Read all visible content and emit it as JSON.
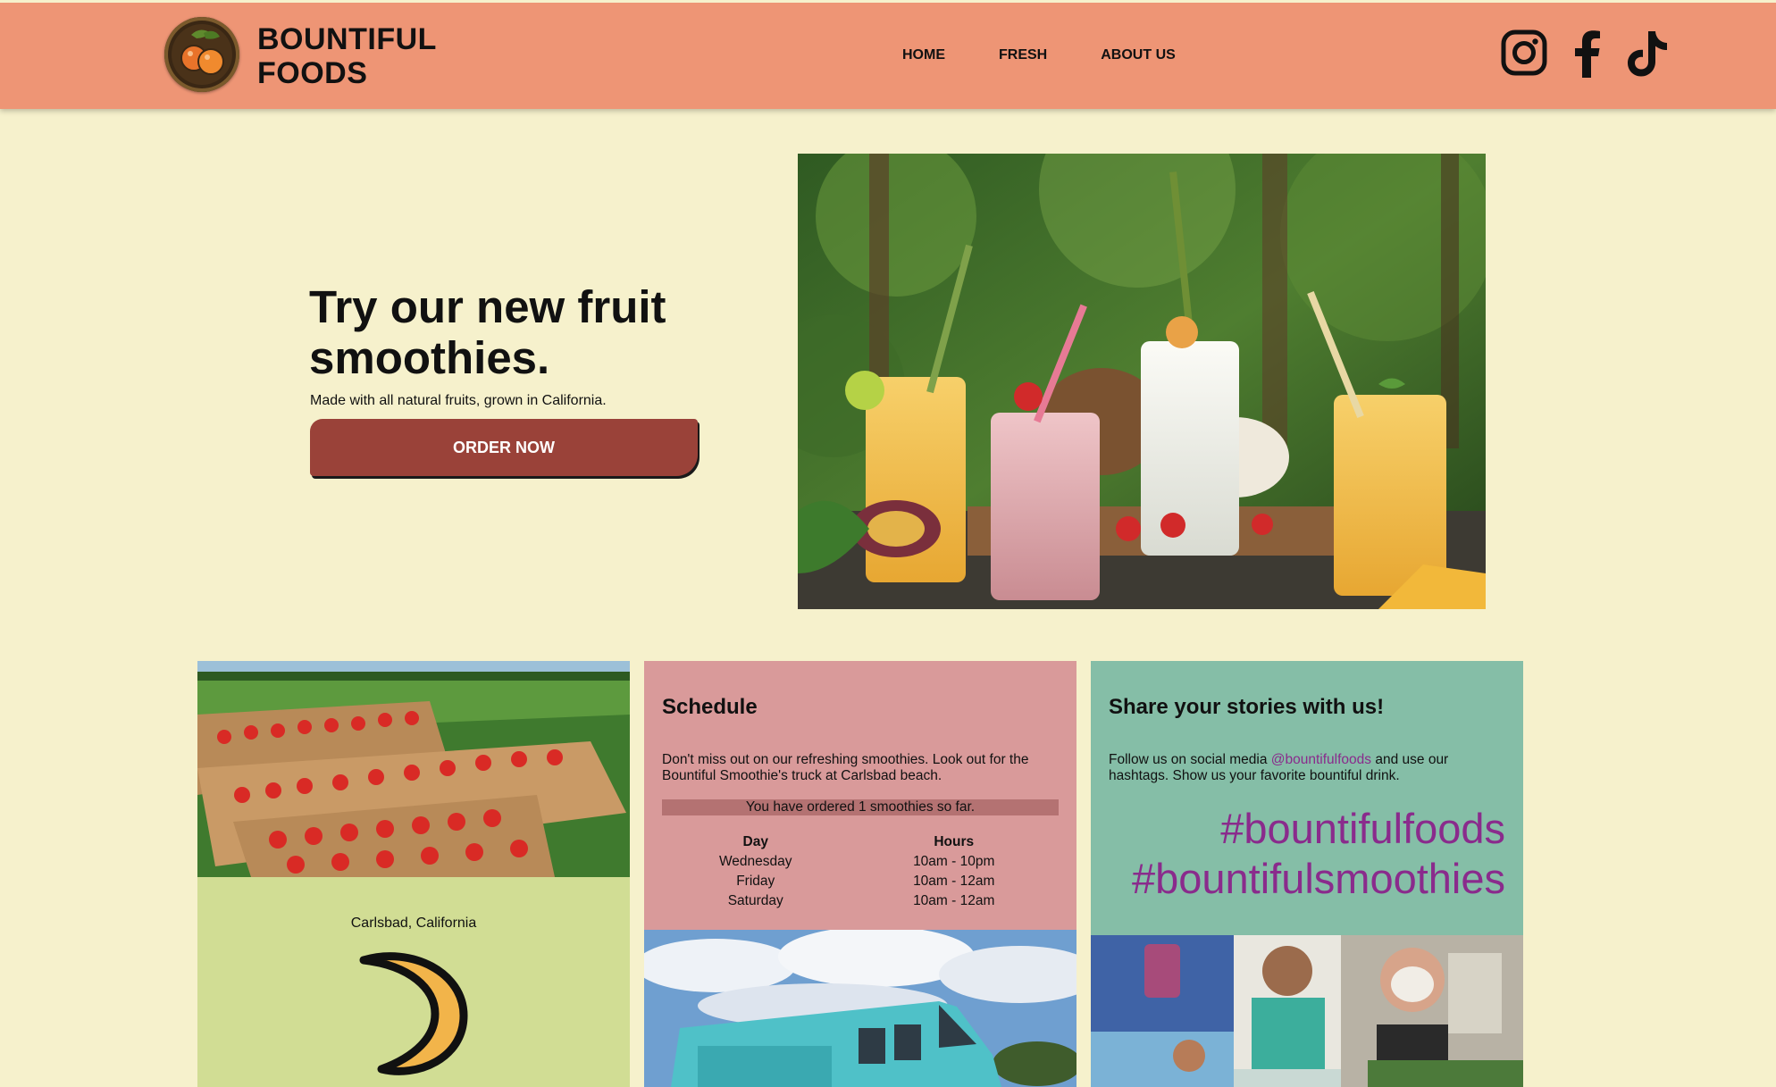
{
  "header": {
    "brand_line1": "BOUNTIFUL",
    "brand_line2": "FOODS",
    "nav": [
      {
        "label": "HOME"
      },
      {
        "label": "FRESH"
      },
      {
        "label": "ABOUT US"
      }
    ],
    "social": [
      "instagram-icon",
      "facebook-icon",
      "tiktok-icon"
    ]
  },
  "hero": {
    "title": "Try our new fruit smoothies.",
    "subtitle": "Made with all natural fruits, grown in California.",
    "button_label": "ORDER NOW"
  },
  "farm_card": {
    "location": "Carlsbad, California"
  },
  "schedule_card": {
    "title": "Schedule",
    "text": "Don't miss out on our refreshing smoothies. Look out for the Bountiful Smoothie's truck at Carlsbad beach.",
    "order_count": "You have ordered 1 smoothies so far.",
    "columns": [
      "Day",
      "Hours"
    ],
    "rows": [
      [
        "Wednesday",
        "10am - 10pm"
      ],
      [
        "Friday",
        "10am - 12am"
      ],
      [
        "Saturday",
        "10am - 12am"
      ]
    ]
  },
  "share_card": {
    "title": "Share your stories with us!",
    "text_before": "Follow us on social media ",
    "handle": "@bountifulfoods",
    "text_after": " and use our hashtags. Show us your favorite bountiful drink.",
    "hashtag1": "#bountifulfoods",
    "hashtag2": "#bountifulsmoothies"
  },
  "colors": {
    "page_bg": "#f6f1cc",
    "header_bg": "#ee9575",
    "button_bg": "#9a4239",
    "farm_card_bg": "#d1dd94",
    "schedule_card_bg": "#d99a9a",
    "share_card_bg": "#85bea7",
    "hashtag": "#8a2b8c"
  }
}
